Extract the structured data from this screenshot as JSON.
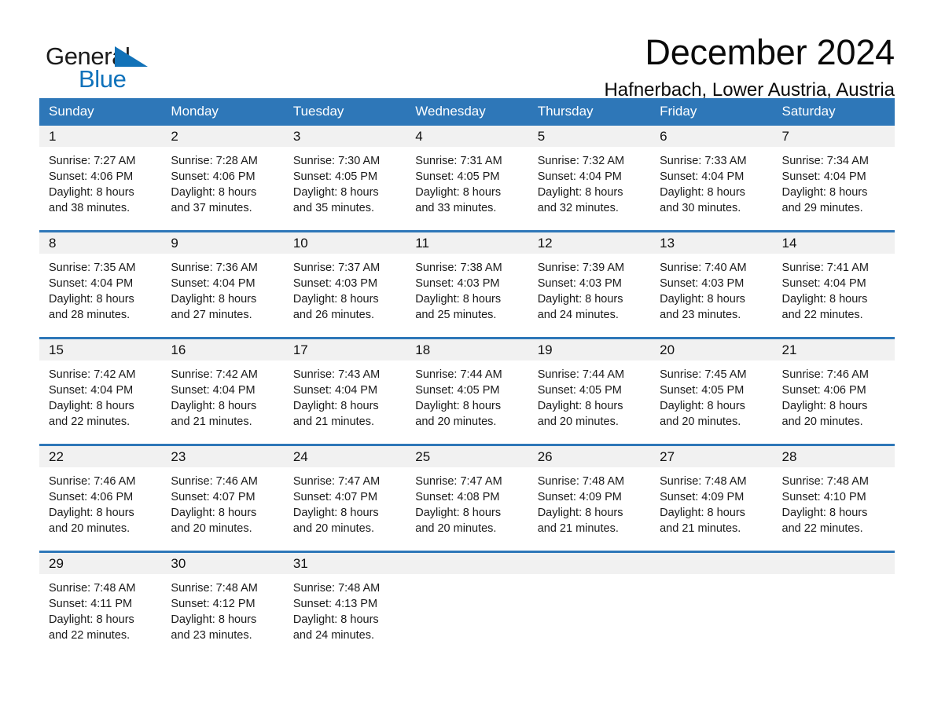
{
  "brand": {
    "name_top": "General",
    "name_bottom": "Blue",
    "accent_color": "#1272b8",
    "flag_icon": "triangle-flag-icon"
  },
  "header": {
    "month_title": "December 2024",
    "location": "Hafnerbach, Lower Austria, Austria"
  },
  "calendar": {
    "header_color": "#2e77b8",
    "date_band_color": "#f1f1f1",
    "day_names": [
      "Sunday",
      "Monday",
      "Tuesday",
      "Wednesday",
      "Thursday",
      "Friday",
      "Saturday"
    ],
    "weeks": [
      {
        "days": [
          {
            "date": "1",
            "sunrise": "Sunrise: 7:27 AM",
            "sunset": "Sunset: 4:06 PM",
            "daylight_1": "Daylight: 8 hours",
            "daylight_2": "and 38 minutes."
          },
          {
            "date": "2",
            "sunrise": "Sunrise: 7:28 AM",
            "sunset": "Sunset: 4:06 PM",
            "daylight_1": "Daylight: 8 hours",
            "daylight_2": "and 37 minutes."
          },
          {
            "date": "3",
            "sunrise": "Sunrise: 7:30 AM",
            "sunset": "Sunset: 4:05 PM",
            "daylight_1": "Daylight: 8 hours",
            "daylight_2": "and 35 minutes."
          },
          {
            "date": "4",
            "sunrise": "Sunrise: 7:31 AM",
            "sunset": "Sunset: 4:05 PM",
            "daylight_1": "Daylight: 8 hours",
            "daylight_2": "and 33 minutes."
          },
          {
            "date": "5",
            "sunrise": "Sunrise: 7:32 AM",
            "sunset": "Sunset: 4:04 PM",
            "daylight_1": "Daylight: 8 hours",
            "daylight_2": "and 32 minutes."
          },
          {
            "date": "6",
            "sunrise": "Sunrise: 7:33 AM",
            "sunset": "Sunset: 4:04 PM",
            "daylight_1": "Daylight: 8 hours",
            "daylight_2": "and 30 minutes."
          },
          {
            "date": "7",
            "sunrise": "Sunrise: 7:34 AM",
            "sunset": "Sunset: 4:04 PM",
            "daylight_1": "Daylight: 8 hours",
            "daylight_2": "and 29 minutes."
          }
        ]
      },
      {
        "days": [
          {
            "date": "8",
            "sunrise": "Sunrise: 7:35 AM",
            "sunset": "Sunset: 4:04 PM",
            "daylight_1": "Daylight: 8 hours",
            "daylight_2": "and 28 minutes."
          },
          {
            "date": "9",
            "sunrise": "Sunrise: 7:36 AM",
            "sunset": "Sunset: 4:04 PM",
            "daylight_1": "Daylight: 8 hours",
            "daylight_2": "and 27 minutes."
          },
          {
            "date": "10",
            "sunrise": "Sunrise: 7:37 AM",
            "sunset": "Sunset: 4:03 PM",
            "daylight_1": "Daylight: 8 hours",
            "daylight_2": "and 26 minutes."
          },
          {
            "date": "11",
            "sunrise": "Sunrise: 7:38 AM",
            "sunset": "Sunset: 4:03 PM",
            "daylight_1": "Daylight: 8 hours",
            "daylight_2": "and 25 minutes."
          },
          {
            "date": "12",
            "sunrise": "Sunrise: 7:39 AM",
            "sunset": "Sunset: 4:03 PM",
            "daylight_1": "Daylight: 8 hours",
            "daylight_2": "and 24 minutes."
          },
          {
            "date": "13",
            "sunrise": "Sunrise: 7:40 AM",
            "sunset": "Sunset: 4:03 PM",
            "daylight_1": "Daylight: 8 hours",
            "daylight_2": "and 23 minutes."
          },
          {
            "date": "14",
            "sunrise": "Sunrise: 7:41 AM",
            "sunset": "Sunset: 4:04 PM",
            "daylight_1": "Daylight: 8 hours",
            "daylight_2": "and 22 minutes."
          }
        ]
      },
      {
        "days": [
          {
            "date": "15",
            "sunrise": "Sunrise: 7:42 AM",
            "sunset": "Sunset: 4:04 PM",
            "daylight_1": "Daylight: 8 hours",
            "daylight_2": "and 22 minutes."
          },
          {
            "date": "16",
            "sunrise": "Sunrise: 7:42 AM",
            "sunset": "Sunset: 4:04 PM",
            "daylight_1": "Daylight: 8 hours",
            "daylight_2": "and 21 minutes."
          },
          {
            "date": "17",
            "sunrise": "Sunrise: 7:43 AM",
            "sunset": "Sunset: 4:04 PM",
            "daylight_1": "Daylight: 8 hours",
            "daylight_2": "and 21 minutes."
          },
          {
            "date": "18",
            "sunrise": "Sunrise: 7:44 AM",
            "sunset": "Sunset: 4:05 PM",
            "daylight_1": "Daylight: 8 hours",
            "daylight_2": "and 20 minutes."
          },
          {
            "date": "19",
            "sunrise": "Sunrise: 7:44 AM",
            "sunset": "Sunset: 4:05 PM",
            "daylight_1": "Daylight: 8 hours",
            "daylight_2": "and 20 minutes."
          },
          {
            "date": "20",
            "sunrise": "Sunrise: 7:45 AM",
            "sunset": "Sunset: 4:05 PM",
            "daylight_1": "Daylight: 8 hours",
            "daylight_2": "and 20 minutes."
          },
          {
            "date": "21",
            "sunrise": "Sunrise: 7:46 AM",
            "sunset": "Sunset: 4:06 PM",
            "daylight_1": "Daylight: 8 hours",
            "daylight_2": "and 20 minutes."
          }
        ]
      },
      {
        "days": [
          {
            "date": "22",
            "sunrise": "Sunrise: 7:46 AM",
            "sunset": "Sunset: 4:06 PM",
            "daylight_1": "Daylight: 8 hours",
            "daylight_2": "and 20 minutes."
          },
          {
            "date": "23",
            "sunrise": "Sunrise: 7:46 AM",
            "sunset": "Sunset: 4:07 PM",
            "daylight_1": "Daylight: 8 hours",
            "daylight_2": "and 20 minutes."
          },
          {
            "date": "24",
            "sunrise": "Sunrise: 7:47 AM",
            "sunset": "Sunset: 4:07 PM",
            "daylight_1": "Daylight: 8 hours",
            "daylight_2": "and 20 minutes."
          },
          {
            "date": "25",
            "sunrise": "Sunrise: 7:47 AM",
            "sunset": "Sunset: 4:08 PM",
            "daylight_1": "Daylight: 8 hours",
            "daylight_2": "and 20 minutes."
          },
          {
            "date": "26",
            "sunrise": "Sunrise: 7:48 AM",
            "sunset": "Sunset: 4:09 PM",
            "daylight_1": "Daylight: 8 hours",
            "daylight_2": "and 21 minutes."
          },
          {
            "date": "27",
            "sunrise": "Sunrise: 7:48 AM",
            "sunset": "Sunset: 4:09 PM",
            "daylight_1": "Daylight: 8 hours",
            "daylight_2": "and 21 minutes."
          },
          {
            "date": "28",
            "sunrise": "Sunrise: 7:48 AM",
            "sunset": "Sunset: 4:10 PM",
            "daylight_1": "Daylight: 8 hours",
            "daylight_2": "and 22 minutes."
          }
        ]
      },
      {
        "days": [
          {
            "date": "29",
            "sunrise": "Sunrise: 7:48 AM",
            "sunset": "Sunset: 4:11 PM",
            "daylight_1": "Daylight: 8 hours",
            "daylight_2": "and 22 minutes."
          },
          {
            "date": "30",
            "sunrise": "Sunrise: 7:48 AM",
            "sunset": "Sunset: 4:12 PM",
            "daylight_1": "Daylight: 8 hours",
            "daylight_2": "and 23 minutes."
          },
          {
            "date": "31",
            "sunrise": "Sunrise: 7:48 AM",
            "sunset": "Sunset: 4:13 PM",
            "daylight_1": "Daylight: 8 hours",
            "daylight_2": "and 24 minutes."
          },
          {
            "date": "",
            "sunrise": "",
            "sunset": "",
            "daylight_1": "",
            "daylight_2": ""
          },
          {
            "date": "",
            "sunrise": "",
            "sunset": "",
            "daylight_1": "",
            "daylight_2": ""
          },
          {
            "date": "",
            "sunrise": "",
            "sunset": "",
            "daylight_1": "",
            "daylight_2": ""
          },
          {
            "date": "",
            "sunrise": "",
            "sunset": "",
            "daylight_1": "",
            "daylight_2": ""
          }
        ]
      }
    ]
  }
}
